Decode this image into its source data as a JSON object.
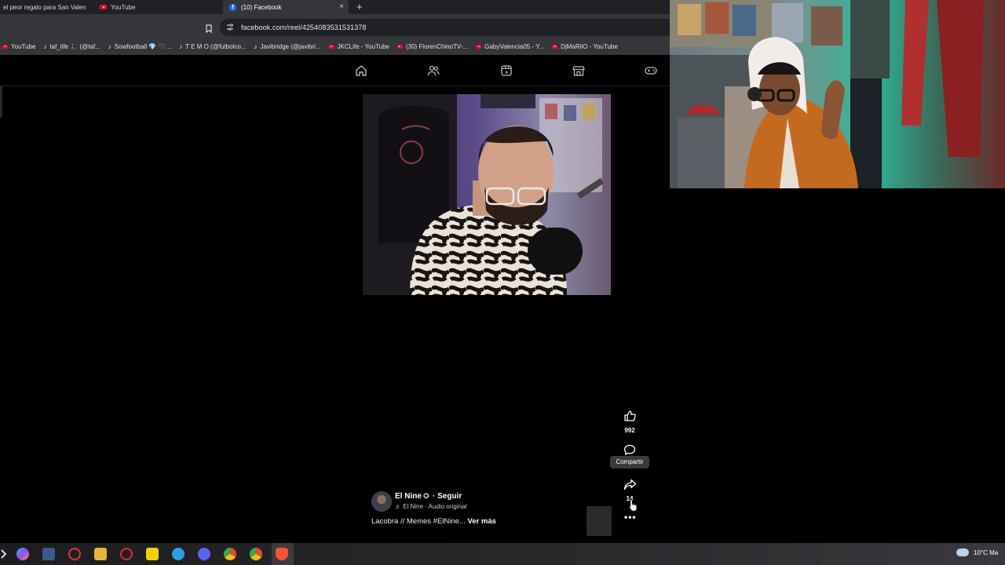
{
  "browser": {
    "tabs": [
      {
        "label": "el peor regalo para San Valen",
        "favicon": "none",
        "active": false
      },
      {
        "label": "YouTube",
        "favicon": "youtube-icon",
        "active": false
      },
      {
        "label": "(10) Facebook",
        "favicon": "facebook-icon",
        "active": true
      }
    ],
    "new_tab_glyph": "+",
    "close_glyph": "×",
    "url": "facebook.com/reel/4254083531531378",
    "bookmarks": [
      {
        "label": "YouTube",
        "favicon": "youtube-icon"
      },
      {
        "label": "taf_life 🎩 (@taf...",
        "favicon": "tiktok-icon"
      },
      {
        "label": "Sowfootball 💎 🖤...",
        "favicon": "tiktok-icon"
      },
      {
        "label": "T E M O (@futbolco...",
        "favicon": "tiktok-icon"
      },
      {
        "label": "Javibridge (@javibri...",
        "favicon": "tiktok-icon"
      },
      {
        "label": "JKCLife - YouTube",
        "favicon": "youtube-icon"
      },
      {
        "label": "(30) FlorenChinoTV-...",
        "favicon": "youtube-icon"
      },
      {
        "label": "GabyValencia05 - Y...",
        "favicon": "youtube-icon"
      },
      {
        "label": "DjMaRiiO - YouTube",
        "favicon": "youtube-icon"
      }
    ]
  },
  "facebook_nav": {
    "icons": [
      "home-icon",
      "friends-icon",
      "video-icon",
      "marketplace-icon",
      "gaming-icon"
    ]
  },
  "reel": {
    "actions": {
      "like_count": "992",
      "tooltip": "Compartir",
      "share_count": "14"
    },
    "author_name": "El Nine",
    "verified_glyph": "✪",
    "follow_label": "· Seguir",
    "audio_label": "♬ El Nine · Audio original",
    "caption": "Lacobra // Memes #ElNine...",
    "caption_more": "Ver más",
    "more_glyph": "•••"
  },
  "taskbar": {
    "weather": "10°C  Ma"
  },
  "colors": {
    "facebook_blue": "#1877f2",
    "youtube_red": "#ff0033",
    "chrome_dark": "#202124",
    "chrome_toolbar": "#35363a"
  }
}
